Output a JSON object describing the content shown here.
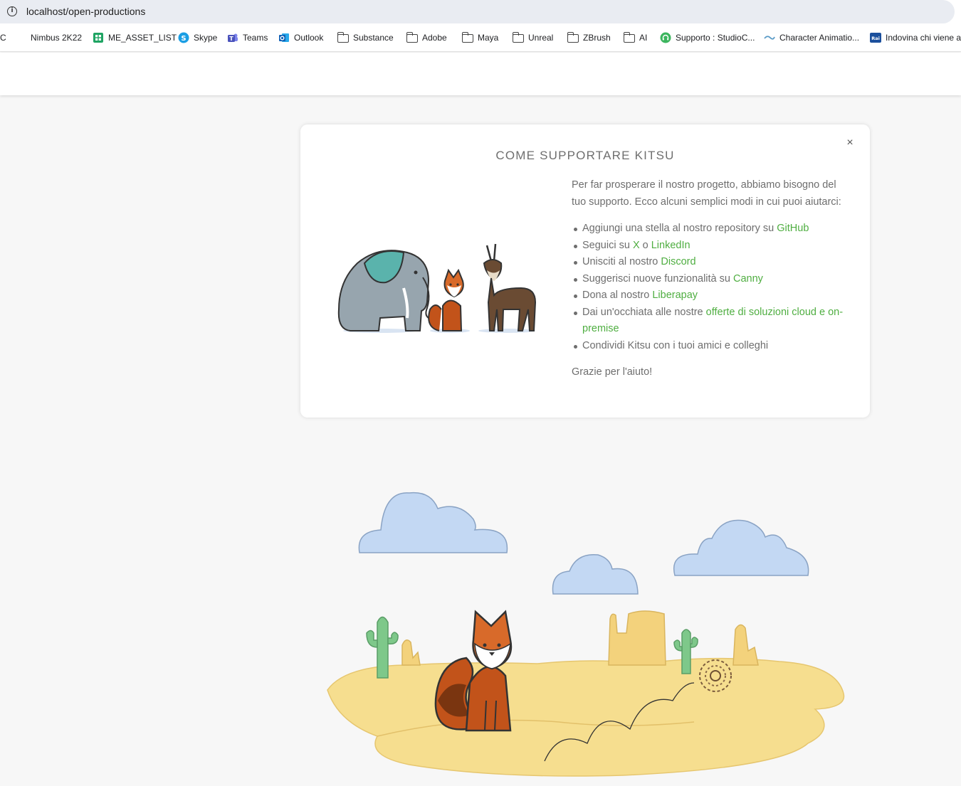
{
  "browser": {
    "url": "localhost/open-productions",
    "bookmarks": [
      {
        "label": "C",
        "icon": "partial-icon"
      },
      {
        "label": "Nimbus 2K22",
        "icon": "blank-icon"
      },
      {
        "label": "ME_ASSET_LIST",
        "icon": "google-sheets-icon"
      },
      {
        "label": "Skype",
        "icon": "skype-icon"
      },
      {
        "label": "Teams",
        "icon": "teams-icon"
      },
      {
        "label": "Outlook",
        "icon": "outlook-icon"
      },
      {
        "label": "Substance",
        "icon": "folder-icon"
      },
      {
        "label": "Adobe",
        "icon": "folder-icon"
      },
      {
        "label": "Maya",
        "icon": "folder-icon"
      },
      {
        "label": "Unreal",
        "icon": "folder-icon"
      },
      {
        "label": "ZBrush",
        "icon": "folder-icon"
      },
      {
        "label": "AI",
        "icon": "folder-icon"
      },
      {
        "label": "Supporto : StudioC...",
        "icon": "headset-icon"
      },
      {
        "label": "Character Animatio...",
        "icon": "wave-icon"
      },
      {
        "label": "Indovina chi viene a",
        "icon": "rai-icon"
      }
    ]
  },
  "modal": {
    "title": "COME SUPPORTARE KITSU",
    "close_glyph": "×",
    "intro": "Per far prosperare il nostro progetto, abbiamo bisogno del tuo supporto. Ecco alcuni semplici modi in cui puoi aiutarci:",
    "items": [
      {
        "pre": "Aggiungi una stella al nostro repository su ",
        "link1": "GitHub"
      },
      {
        "pre": "Seguici su ",
        "link1": "X",
        "mid": " o ",
        "link2": "LinkedIn"
      },
      {
        "pre": "Unisciti al nostro ",
        "link1": "Discord"
      },
      {
        "pre": "Suggerisci nuove funzionalità su ",
        "link1": "Canny"
      },
      {
        "pre": "Dona al nostro ",
        "link1": "Liberapay"
      },
      {
        "pre": "Dai un'occhiata alle nostre ",
        "link1": "offerte di soluzioni cloud e on-premise"
      },
      {
        "pre": "Condividi Kitsu con i tuoi amici e colleghi"
      }
    ],
    "outro": "Grazie per l'aiuto!"
  },
  "colors": {
    "link": "#4fae41",
    "background": "#f7f7f7",
    "sky_cloud": "#c3d8f3",
    "sand": "#f6de8f",
    "fox": "#c2531a",
    "cactus": "#7ec88a"
  }
}
